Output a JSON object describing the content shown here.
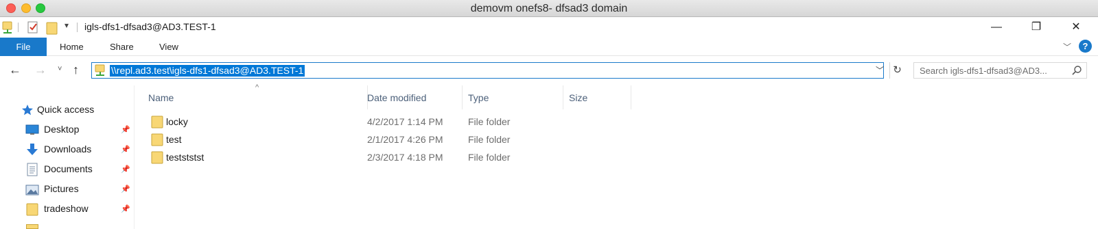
{
  "mac_window": {
    "title": "demovm onefs8- dfsad3 domain"
  },
  "explorer": {
    "title": "igls-dfs1-dfsad3@AD3.TEST-1",
    "window_controls": {
      "minimize": "—",
      "maximize": "❐",
      "close": "✕"
    }
  },
  "ribbon": {
    "tabs": [
      "File",
      "Home",
      "Share",
      "View"
    ],
    "help": "?"
  },
  "address": {
    "path": "\\\\repl.ad3.test\\igls-dfs1-dfsad3@AD3.TEST-1",
    "search_placeholder": "Search igls-dfs1-dfsad3@AD3..."
  },
  "nav": {
    "items": [
      {
        "label": "Quick access",
        "icon": "star-icon",
        "pinned": false
      },
      {
        "label": "Desktop",
        "icon": "desktop-icon",
        "pinned": true
      },
      {
        "label": "Downloads",
        "icon": "download-icon",
        "pinned": true
      },
      {
        "label": "Documents",
        "icon": "documents-icon",
        "pinned": true
      },
      {
        "label": "Pictures",
        "icon": "pictures-icon",
        "pinned": true
      },
      {
        "label": "tradeshow",
        "icon": "folder-icon",
        "pinned": true
      }
    ]
  },
  "file_list": {
    "columns": [
      "Name",
      "Date modified",
      "Type",
      "Size"
    ],
    "rows": [
      {
        "name": "locky",
        "date": "4/2/2017 1:14 PM",
        "type": "File folder",
        "size": ""
      },
      {
        "name": "test",
        "date": "2/1/2017 4:26 PM",
        "type": "File folder",
        "size": ""
      },
      {
        "name": "testststst",
        "date": "2/3/2017 4:18 PM",
        "type": "File folder",
        "size": ""
      }
    ]
  },
  "colors": {
    "accent": "#1979ca",
    "selection": "#0078d7",
    "folder": "#f8d775"
  }
}
